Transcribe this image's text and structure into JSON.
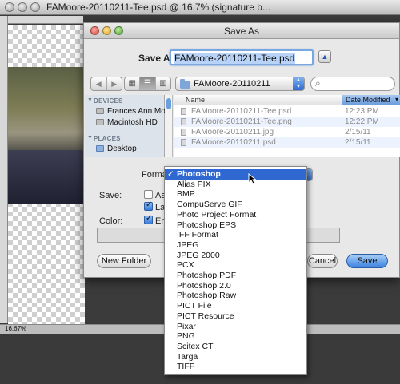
{
  "photoshop": {
    "title": "FAMoore-20110211-Tee.psd @ 16.7% (signature b...",
    "zoom": "16.67%"
  },
  "dialog": {
    "title": "Save As",
    "save_as_label": "Save As:",
    "filename": "FAMoore-20110211-Tee.psd",
    "location": "FAMoore-20110211",
    "search_placeholder": "",
    "sidebar": {
      "devices_header": "DEVICES",
      "devices": [
        "Frances Ann Mo...",
        "Macintosh HD"
      ],
      "places_header": "PLACES",
      "places": [
        "Desktop"
      ]
    },
    "columns": {
      "name": "Name",
      "date": "Date Modified"
    },
    "files": [
      {
        "name": "FAMoore-20110211-Tee.psd",
        "date": "12:23 PM"
      },
      {
        "name": "FAMoore-20110211-Tee.png",
        "date": "12:22 PM"
      },
      {
        "name": "FAMoore-20110211.jpg",
        "date": "2/15/11"
      },
      {
        "name": "FAMoore-20110211.psd",
        "date": "2/15/11"
      }
    ],
    "format_label": "Format",
    "save_label": "Save:",
    "color_label": "Color:",
    "opt_as": "As",
    "opt_layers": "Lay",
    "opt_embed": "Em",
    "buttons": {
      "new_folder": "New Folder",
      "cancel": "Cancel",
      "save": "Save"
    }
  },
  "format_menu": {
    "selected": "Photoshop",
    "items": [
      "Photoshop",
      "Alias PIX",
      "BMP",
      "CompuServe GIF",
      "Photo Project Format",
      "Photoshop EPS",
      "IFF Format",
      "JPEG",
      "JPEG 2000",
      "PCX",
      "Photoshop PDF",
      "Photoshop 2.0",
      "Photoshop Raw",
      "PICT File",
      "PICT Resource",
      "Pixar",
      "PNG",
      "Scitex CT",
      "Targa",
      "TIFF"
    ]
  },
  "colors": {
    "accent": "#2f68d1",
    "selection": "#b8d3f7"
  }
}
